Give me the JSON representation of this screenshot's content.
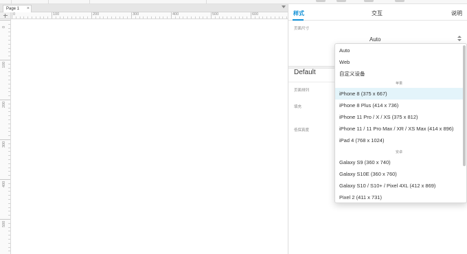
{
  "canvas": {
    "tab_label": "Page 1",
    "ruler_x_labels": [
      "0",
      "100",
      "200",
      "300",
      "400",
      "500",
      "600"
    ],
    "ruler_y_labels": [
      "0",
      "100",
      "200",
      "300",
      "400",
      "500"
    ]
  },
  "inspector": {
    "tabs": [
      {
        "label": "样式",
        "active": true
      },
      {
        "label": "交互",
        "active": false
      },
      {
        "label": "说明",
        "active": false
      }
    ],
    "page_size_label": "页面尺寸",
    "page_size_value": "Auto",
    "section_title": "Default",
    "props": [
      "页面排列",
      "填充",
      "低保真度"
    ]
  },
  "dropdown": {
    "items_top": [
      "Auto",
      "Web",
      "自定义设备"
    ],
    "group_apple": "苹果",
    "apple_devices": [
      "iPhone 8  (375 x 667)",
      "iPhone 8 Plus  (414 x 736)",
      "iPhone 11 Pro / X / XS  (375 x 812)",
      "iPhone 11 / 11 Pro Max / XR / XS Max  (414 x 896)",
      "iPad 4  (768 x 1024)"
    ],
    "group_android": "安卓",
    "android_devices": [
      "Galaxy S9  (360 x 740)",
      "Galaxy S10E  (360 x 760)",
      "Galaxy S10 / S10+ / Pixel 4XL  (412 x 869)",
      "Pixel 2  (411 x 731)"
    ],
    "selected": "iPhone 8  (375 x 667)"
  },
  "colors": {
    "accent": "#0e8fd6",
    "selected_row": "#e3f4fa"
  }
}
